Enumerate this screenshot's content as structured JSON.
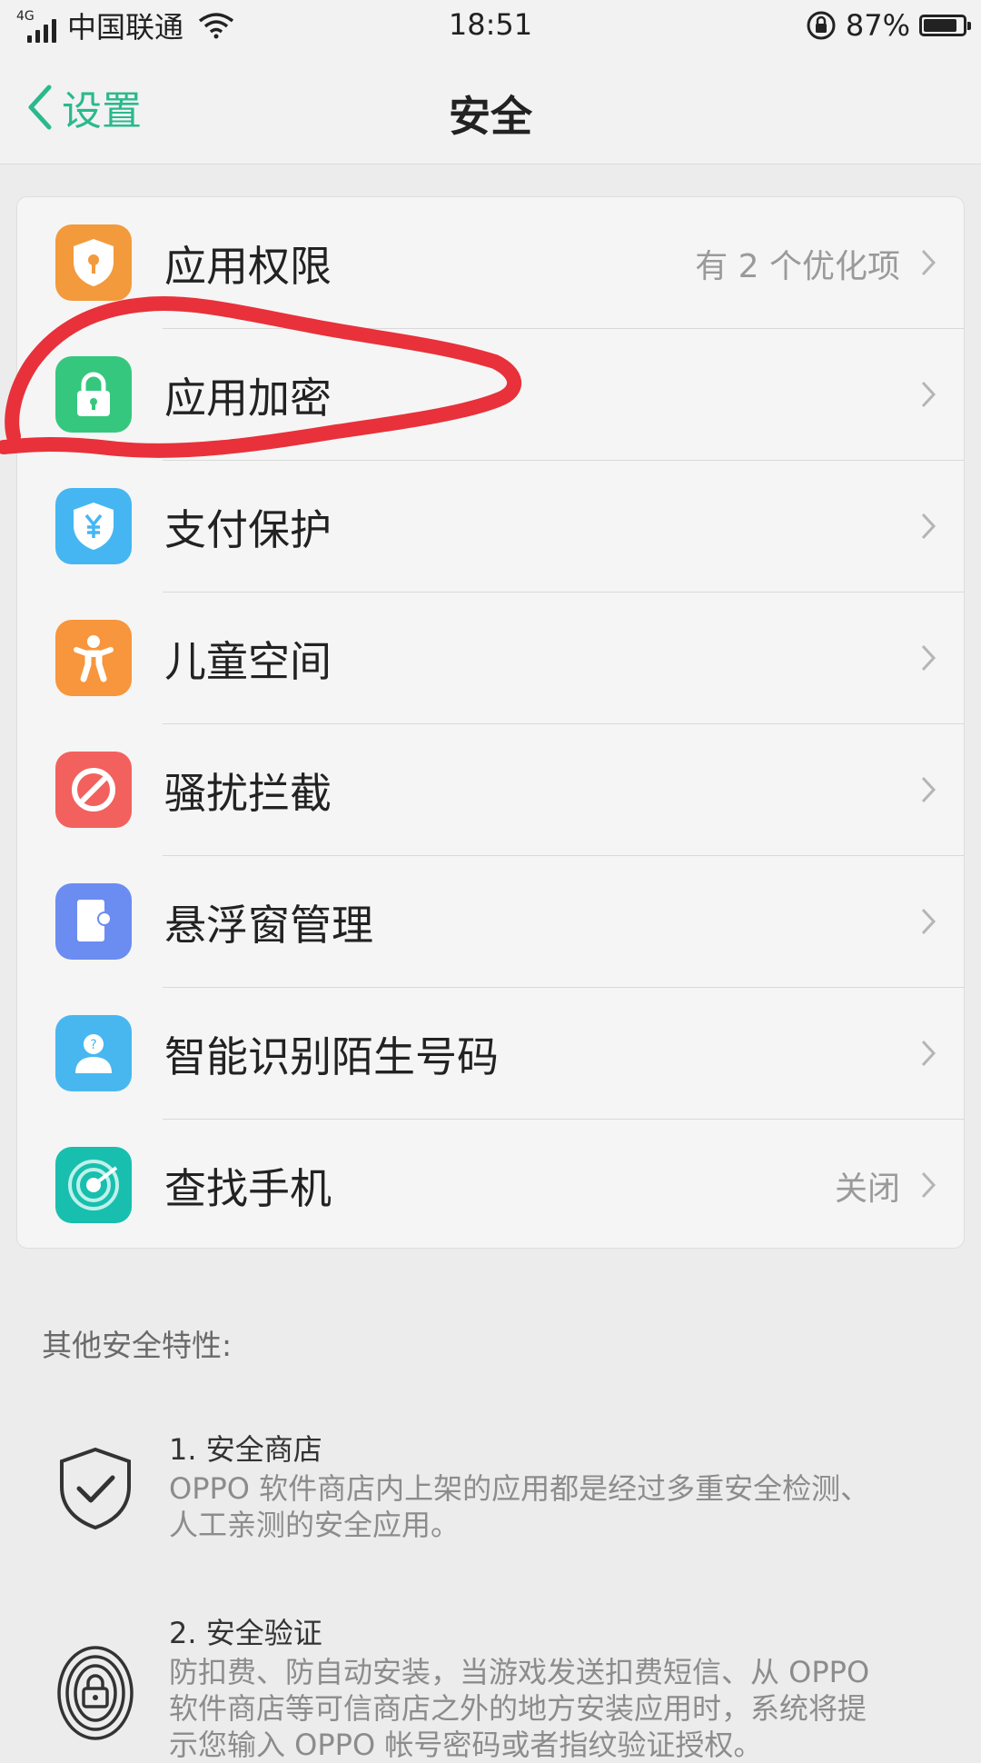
{
  "status_bar": {
    "network": "4G",
    "carrier": "中国联通",
    "time": "18:51",
    "battery_percent": "87%",
    "battery_level": 0.87
  },
  "header": {
    "back_label": "设置",
    "title": "安全"
  },
  "settings": [
    {
      "label": "应用权限",
      "value": "有 2 个优化项",
      "icon": "shield-key-icon",
      "color": "#f39a3c"
    },
    {
      "label": "应用加密",
      "value": "",
      "icon": "lock-icon",
      "color": "#36c77e"
    },
    {
      "label": "支付保护",
      "value": "",
      "icon": "shield-yen-icon",
      "color": "#45b6f2"
    },
    {
      "label": "儿童空间",
      "value": "",
      "icon": "child-icon",
      "color": "#f7963c"
    },
    {
      "label": "骚扰拦截",
      "value": "",
      "icon": "block-icon",
      "color": "#f2615e"
    },
    {
      "label": "悬浮窗管理",
      "value": "",
      "icon": "floating-window-icon",
      "color": "#6b8cf0"
    },
    {
      "label": "智能识别陌生号码",
      "value": "",
      "icon": "unknown-contact-icon",
      "color": "#48b7f0"
    },
    {
      "label": "查找手机",
      "value": "关闭",
      "icon": "radar-icon",
      "color": "#18bfae"
    }
  ],
  "other_features": {
    "title": "其他安全特性:",
    "items": [
      {
        "title": "1. 安全商店",
        "lines": [
          "OPPO 软件商店内上架的应用都是经过多重安全检测、",
          "人工亲测的安全应用。"
        ],
        "icon": "shield-check-icon"
      },
      {
        "title": "2. 安全验证",
        "lines": [
          "防扣费、防自动安装，当游戏发送扣费短信、从 OPPO",
          "软件商店等可信商店之外的地方安装应用时，系统将提",
          "示您输入 OPPO 帐号密码或者指纹验证授权。"
        ],
        "icon": "fingerprint-lock-icon"
      }
    ]
  },
  "colors": {
    "accent": "#2ab98c",
    "annotation": "#e8313a"
  }
}
